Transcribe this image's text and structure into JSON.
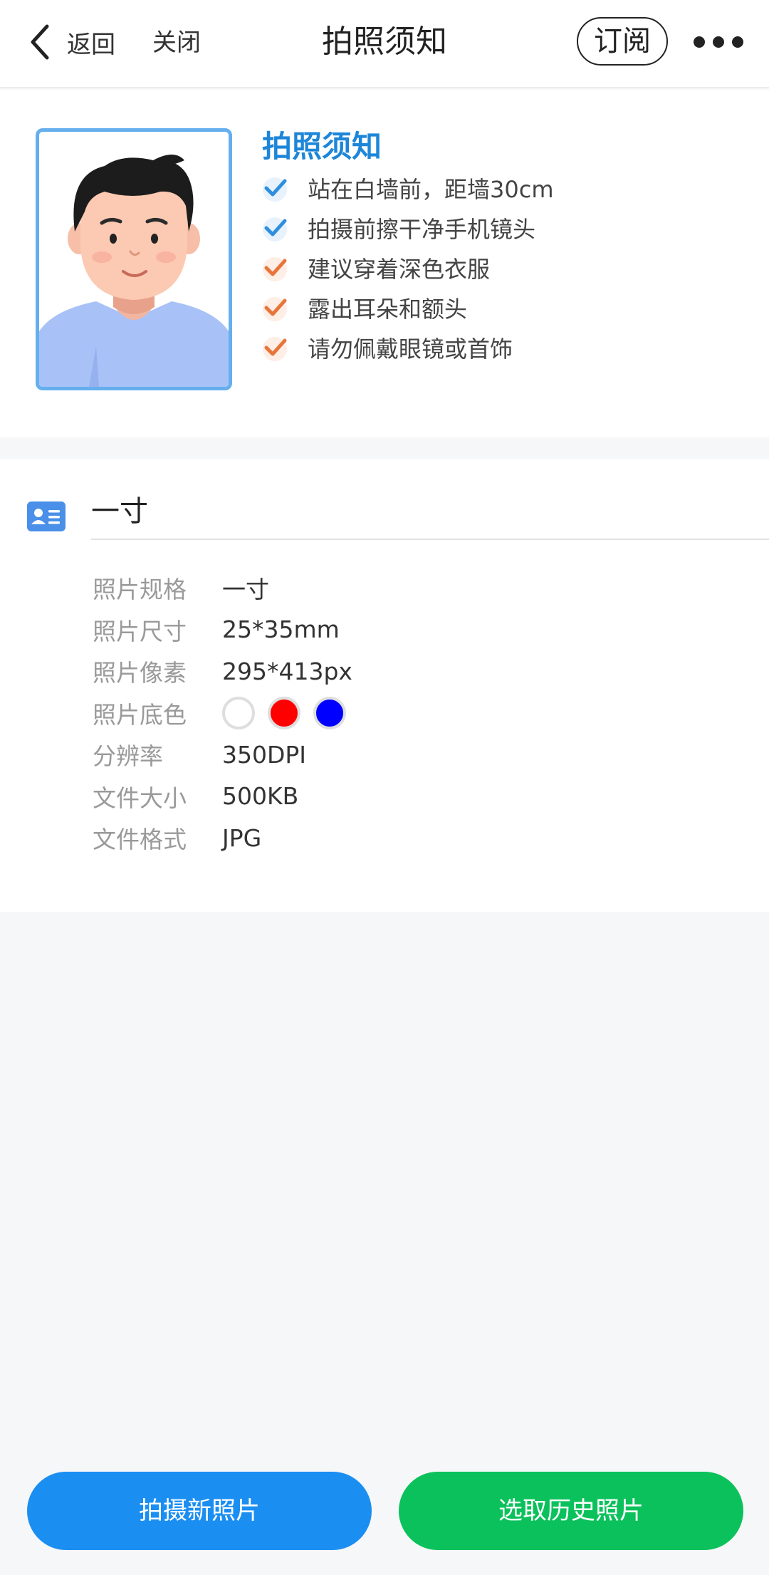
{
  "nav": {
    "back_label": "返回",
    "close_label": "关闭",
    "title": "拍照须知",
    "subscribe_label": "订阅"
  },
  "guide": {
    "title": "拍照须知",
    "tips": [
      {
        "text": "站在白墙前，距墙30cm",
        "check_color": "#2e8ee0"
      },
      {
        "text": "拍摄前擦干净手机镜头",
        "check_color": "#2e8ee0"
      },
      {
        "text": "建议穿着深色衣服",
        "check_color": "#e8743a"
      },
      {
        "text": "露出耳朵和额头",
        "check_color": "#e8743a"
      },
      {
        "text": "请勿佩戴眼镜或首饰",
        "check_color": "#e8743a"
      }
    ]
  },
  "spec": {
    "name": "一寸",
    "rows": {
      "format": {
        "label": "照片规格",
        "value": "一寸"
      },
      "size": {
        "label": "照片尺寸",
        "value": "25*35mm"
      },
      "pixels": {
        "label": "照片像素",
        "value": "295*413px"
      },
      "background": {
        "label": "照片底色",
        "colors": [
          "#ffffff",
          "#ff0000",
          "#0000ff"
        ]
      },
      "resolution": {
        "label": "分辨率",
        "value": "350DPI"
      },
      "file_size": {
        "label": "文件大小",
        "value": "500KB"
      },
      "file_format": {
        "label": "文件格式",
        "value": "JPG"
      }
    }
  },
  "actions": {
    "capture_label": "拍摄新照片",
    "history_label": "选取历史照片"
  },
  "colors": {
    "accent_blue": "#1b8ef2",
    "accent_green": "#0bc15b",
    "guide_title": "#1d86d8"
  }
}
